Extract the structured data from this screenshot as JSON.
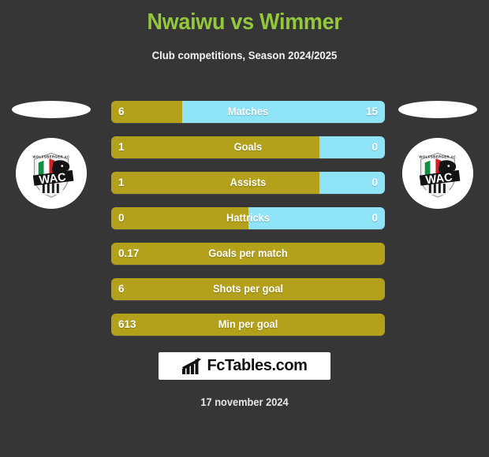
{
  "header": {
    "title": "Nwaiwu vs Wimmer",
    "subtitle": "Club competitions, Season 2024/2025",
    "title_color": "#93c83d",
    "subtitle_color": "#f2f2f2"
  },
  "theme": {
    "background": "#363636",
    "left_bar_color": "#b3a11b",
    "right_bar_color": "#8fe4f8",
    "text_color": "#ffffff"
  },
  "players": {
    "left": {
      "name": "Nwaiwu",
      "crest": "wac-club-crest",
      "crest_text": "WAC"
    },
    "right": {
      "name": "Wimmer",
      "crest": "wac-club-crest",
      "crest_text": "WAC"
    }
  },
  "chart_data": {
    "type": "bar",
    "title": "Nwaiwu vs Wimmer",
    "subtitle": "Club competitions, Season 2024/2025",
    "orientation": "horizontal-diverging",
    "series": [
      {
        "name": "Nwaiwu",
        "color": "#b3a11b"
      },
      {
        "name": "Wimmer",
        "color": "#8fe4f8"
      }
    ],
    "categories": [
      "Matches",
      "Goals",
      "Assists",
      "Hattricks",
      "Goals per match",
      "Shots per goal",
      "Min per goal"
    ],
    "rows": [
      {
        "label": "Matches",
        "left": "6",
        "right": "15",
        "left_pct": 26,
        "two_sided": true
      },
      {
        "label": "Goals",
        "left": "1",
        "right": "0",
        "left_pct": 76,
        "two_sided": true
      },
      {
        "label": "Assists",
        "left": "1",
        "right": "0",
        "left_pct": 76,
        "two_sided": true
      },
      {
        "label": "Hattricks",
        "left": "0",
        "right": "0",
        "left_pct": 50,
        "two_sided": true
      },
      {
        "label": "Goals per match",
        "left": "0.17",
        "right": "",
        "left_pct": 100,
        "two_sided": false
      },
      {
        "label": "Shots per goal",
        "left": "6",
        "right": "",
        "left_pct": 100,
        "two_sided": false
      },
      {
        "label": "Min per goal",
        "left": "613",
        "right": "",
        "left_pct": 100,
        "two_sided": false
      }
    ]
  },
  "footer": {
    "logo_text": "FcTables.com",
    "logo_icon": "bar-chart-icon",
    "date": "17 november 2024"
  }
}
